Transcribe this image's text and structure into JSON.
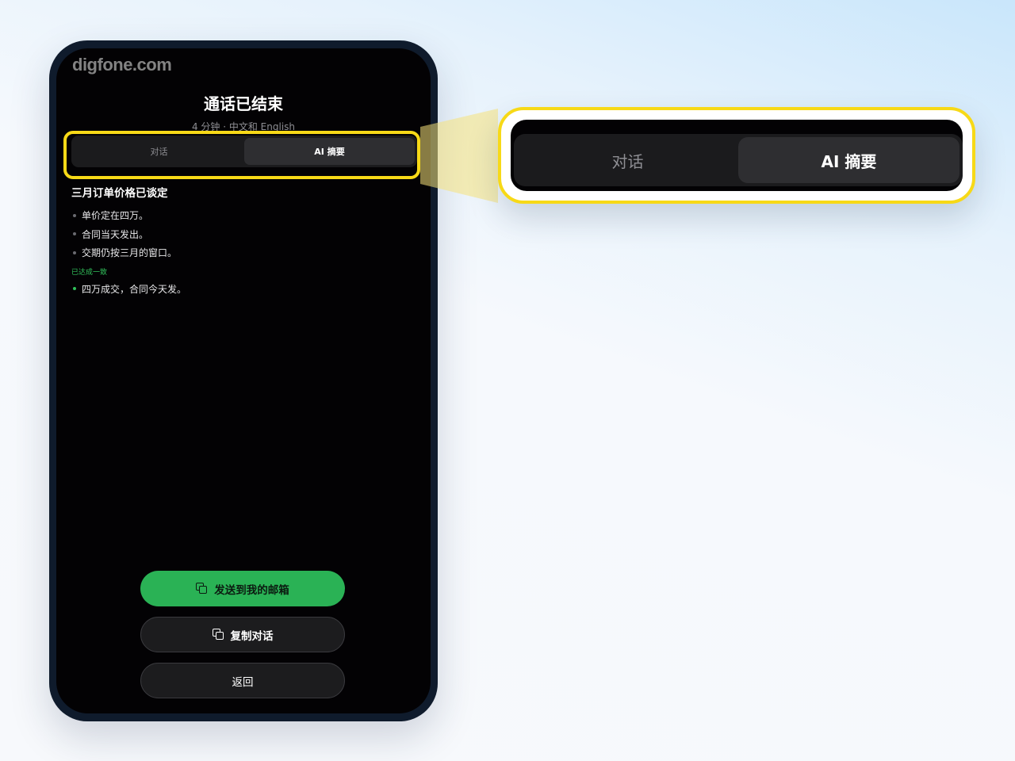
{
  "watermark": "digfone.com",
  "call": {
    "title": "通话已结束",
    "subtitle": "4 分钟 · 中文和 English"
  },
  "tabs": [
    {
      "label": "对话",
      "active": false
    },
    {
      "label": "AI 摘要",
      "active": true
    }
  ],
  "summary": {
    "heading": "三月订单价格已谈定",
    "points": [
      "单价定在四万。",
      "合同当天发出。",
      "交期仍按三月的窗口。"
    ],
    "agreement_label": "已达成一致",
    "agreement_points": [
      "四万成交，合同今天发。"
    ]
  },
  "actions": {
    "email_label": "发送到我的邮箱",
    "copy_label": "复制对话",
    "back_label": "返回"
  },
  "colors": {
    "accent_green": "#2ab255",
    "highlight_yellow": "#f7d917",
    "screen_bg": "#030204"
  },
  "icons": {
    "email_button": "copy-icon",
    "copy_button": "copy-icon"
  }
}
